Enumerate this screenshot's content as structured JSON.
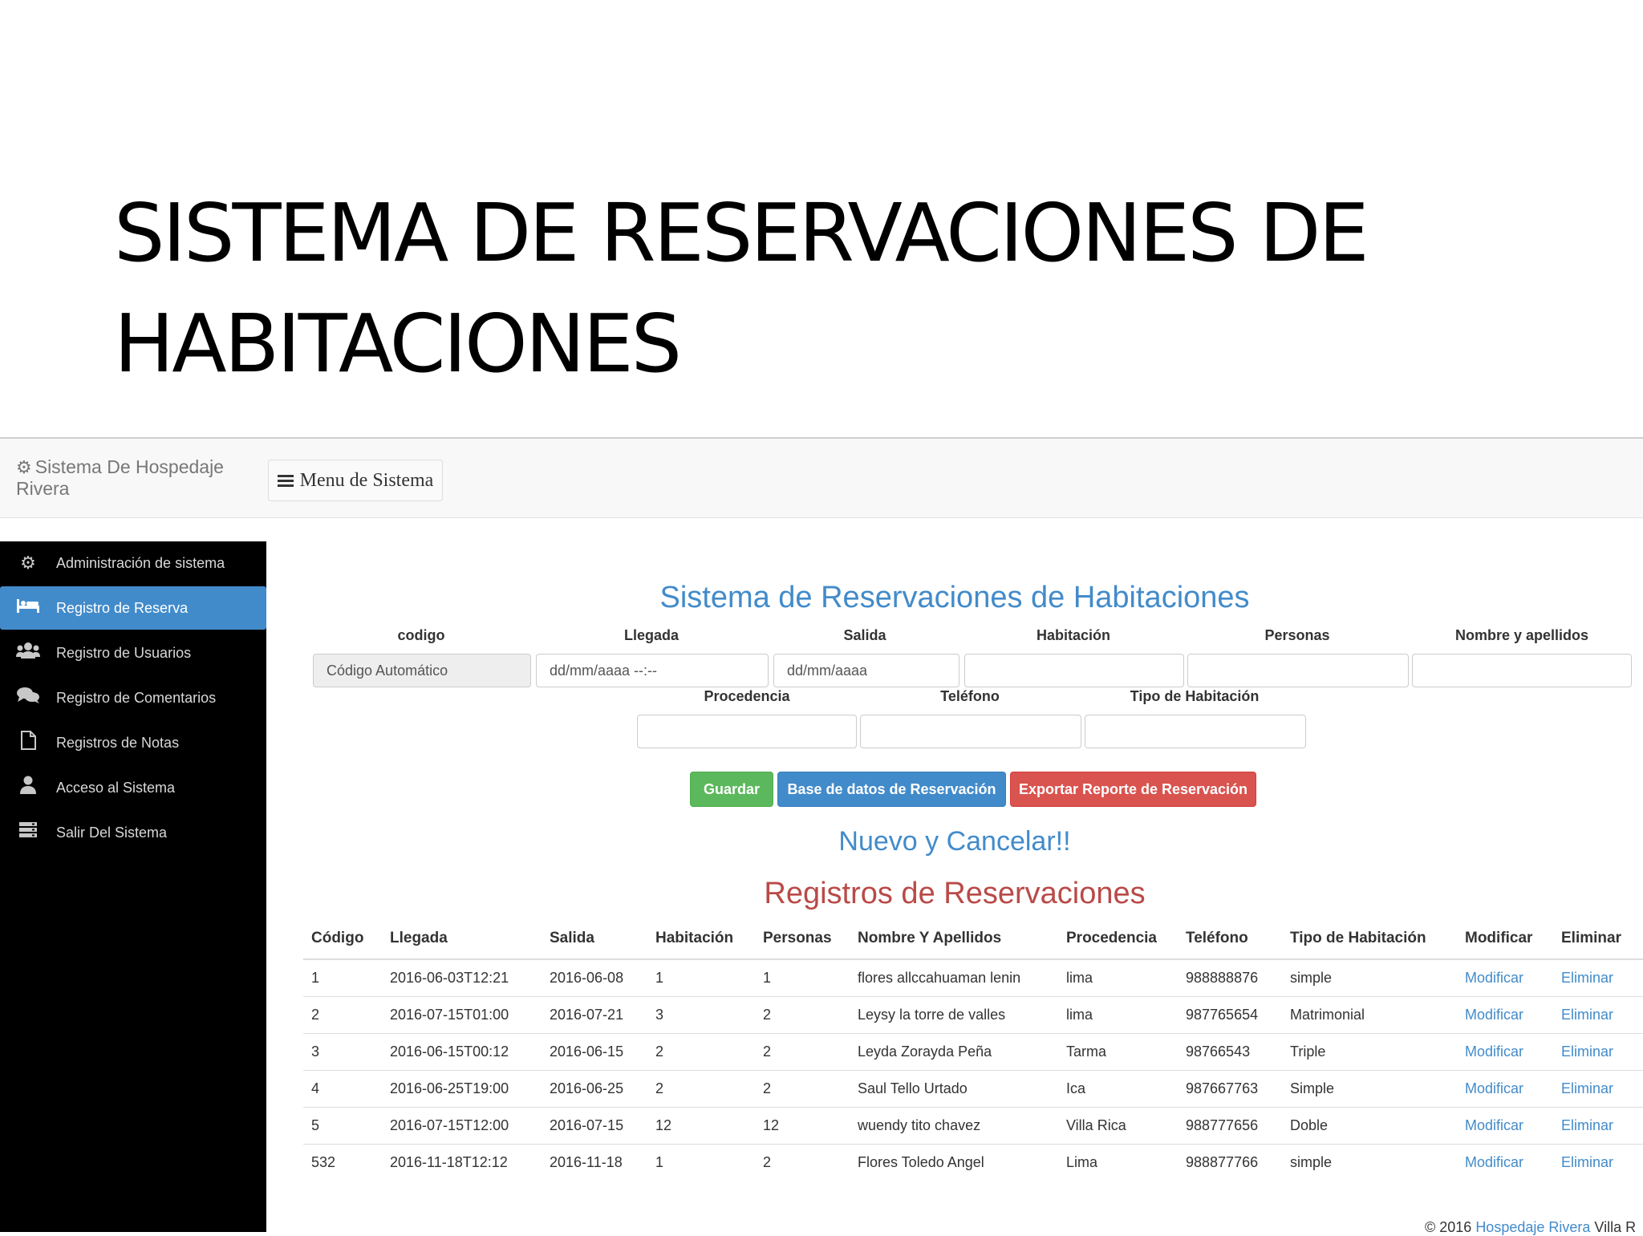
{
  "slide": {
    "title_line1": "SISTEMA DE RESERVACIONES DE",
    "title_line2": "HABITACIONES"
  },
  "navbar": {
    "brand": "Sistema De Hospedaje Rivera",
    "brand_icon": "gear-icon",
    "menu_label": "Menu de Sistema"
  },
  "sidebar": {
    "items": [
      {
        "label": "Administración de sistema",
        "icon": "gear-icon"
      },
      {
        "label": "Registro de Reserva",
        "icon": "bed-icon",
        "active": true
      },
      {
        "label": "Registro de Usuarios",
        "icon": "users-icon"
      },
      {
        "label": "Registro de Comentarios",
        "icon": "comments-icon"
      },
      {
        "label": "Registros de Notas",
        "icon": "file-icon"
      },
      {
        "label": "Acceso al Sistema",
        "icon": "user-icon"
      },
      {
        "label": "Salir Del Sistema",
        "icon": "server-icon"
      }
    ]
  },
  "form": {
    "heading": "Sistema de Reservaciones de Habitaciones",
    "labels": {
      "codigo": "codigo",
      "llegada": "Llegada",
      "salida": "Salida",
      "habitacion": "Habitación",
      "personas": "Personas",
      "nombre": "Nombre y apellidos",
      "procedencia": "Procedencia",
      "telefono": "Teléfono",
      "tipo": "Tipo de Habitación"
    },
    "values": {
      "codigo": "Código Automático",
      "llegada": "dd/mm/aaaa --:--",
      "salida": "dd/mm/aaaa"
    },
    "buttons": {
      "guardar": "Guardar",
      "base": "Base de datos de Reservación",
      "exportar": "Exportar Reporte de Reservación"
    },
    "nuevo": "Nuevo y Cancelar!!"
  },
  "registros": {
    "heading": "Registros de Reservaciones",
    "columns": [
      "Código",
      "Llegada",
      "Salida",
      "Habitación",
      "Personas",
      "Nombre Y Apellidos",
      "Procedencia",
      "Teléfono",
      "Tipo de Habitación",
      "Modificar",
      "Eliminar"
    ],
    "rows": [
      [
        "1",
        "2016-06-03T12:21",
        "2016-06-08",
        "1",
        "1",
        "flores allccahuaman lenin",
        "lima",
        "988888876",
        "simple",
        "Modificar",
        "Eliminar"
      ],
      [
        "2",
        "2016-07-15T01:00",
        "2016-07-21",
        "3",
        "2",
        "Leysy la torre de valles",
        "lima",
        "987765654",
        "Matrimonial",
        "Modificar",
        "Eliminar"
      ],
      [
        "3",
        "2016-06-15T00:12",
        "2016-06-15",
        "2",
        "2",
        "Leyda Zorayda Peña",
        "Tarma",
        "98766543",
        "Triple",
        "Modificar",
        "Eliminar"
      ],
      [
        "4",
        "2016-06-25T19:00",
        "2016-06-25",
        "2",
        "2",
        "Saul Tello Urtado",
        "Ica",
        "987667763",
        "Simple",
        "Modificar",
        "Eliminar"
      ],
      [
        "5",
        "2016-07-15T12:00",
        "2016-07-15",
        "12",
        "12",
        "wuendy tito chavez",
        "Villa Rica",
        "988777656",
        "Doble",
        "Modificar",
        "Eliminar"
      ],
      [
        "532",
        "2016-11-18T12:12",
        "2016-11-18",
        "1",
        "2",
        "Flores Toledo Angel",
        "Lima",
        "988877766",
        "simple",
        "Modificar",
        "Eliminar"
      ]
    ]
  },
  "footer": {
    "prefix": "© 2016 ",
    "link": "Hospedaje Rivera",
    "suffix": " Villa R"
  }
}
